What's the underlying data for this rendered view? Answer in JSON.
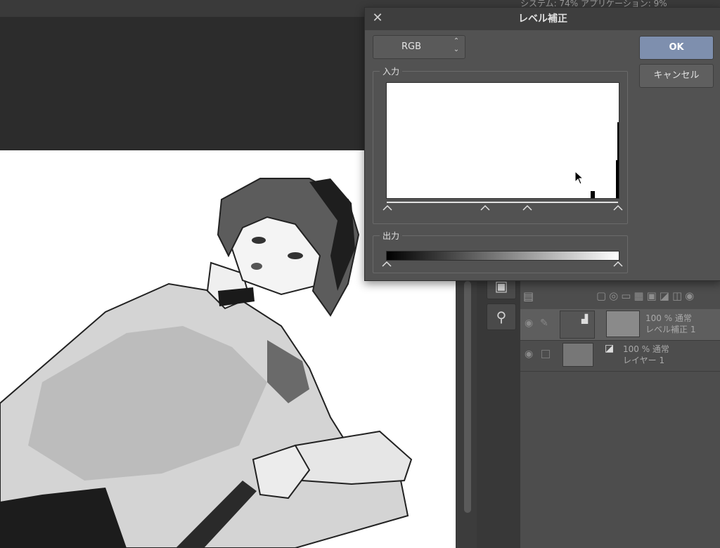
{
  "topbar": {
    "status_text": "システム: 74% アプリケーション: 9%"
  },
  "dialog": {
    "title": "レベル補正",
    "close_icon": "close-icon",
    "channel": {
      "selected": "RGB",
      "stepper_icon": "up-down-stepper-icon"
    },
    "input_section": {
      "label": "入力"
    },
    "output_section": {
      "label": "出力"
    },
    "ok_label": "OK",
    "cancel_label": "キャンセル"
  },
  "layers": [
    {
      "opacity_mode": "100 % 通常",
      "name": "レベル補正 1",
      "selected": true
    },
    {
      "opacity_mode": "100 % 通常",
      "name": "レイヤー 1",
      "selected": false
    }
  ],
  "colors": {
    "accent_button": "#7e8fae",
    "dialog_bg": "#525252",
    "panel_bg": "#4d4d4d"
  }
}
